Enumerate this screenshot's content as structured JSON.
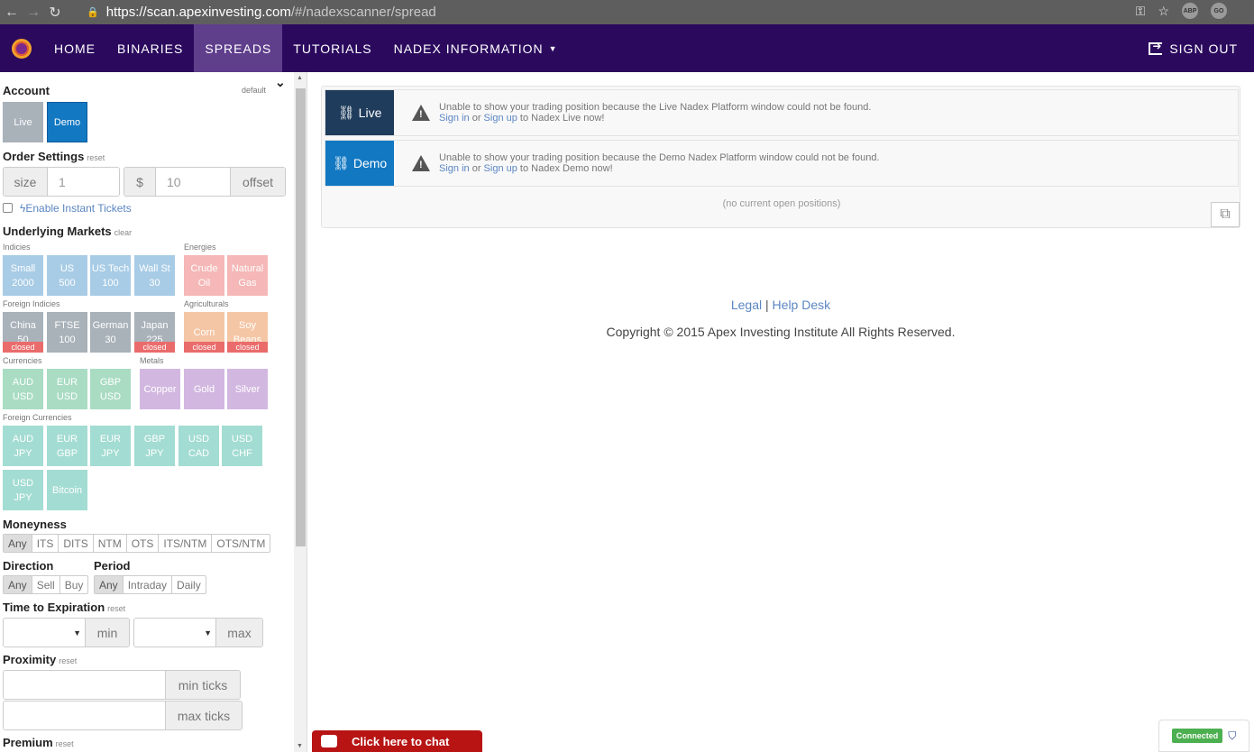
{
  "browser": {
    "url_host": "https://scan.apexinvesting.com",
    "url_path": "/#/nadexscanner/spread",
    "ext1": "ABP",
    "ext2": "GO"
  },
  "navbar": {
    "items": [
      "HOME",
      "BINARIES",
      "SPREADS",
      "TUTORIALS",
      "NADEX INFORMATION"
    ],
    "active": "SPREADS",
    "signout": "SIGN OUT"
  },
  "sidebar": {
    "account": {
      "label": "Account",
      "default_link": "default",
      "live": "Live",
      "demo": "Demo"
    },
    "order": {
      "label": "Order Settings",
      "reset": "reset",
      "size_addon": "size",
      "size_value": "1",
      "currency": "$",
      "offset_value": "10",
      "offset_addon": "offset"
    },
    "instant": "Enable Instant Tickets",
    "underlying": {
      "label": "Underlying Markets",
      "clear": "clear"
    },
    "groups": {
      "indicies": "Indicies",
      "energies": "Energies",
      "foreign_indicies": "Foreign Indicies",
      "agriculturals": "Agriculturals",
      "currencies": "Currencies",
      "metals": "Metals",
      "foreign_currencies": "Foreign Currencies"
    },
    "tiles": {
      "indicies": [
        [
          "Small",
          "2000"
        ],
        [
          "US",
          "500"
        ],
        [
          "US Tech",
          "100"
        ],
        [
          "Wall St",
          "30"
        ]
      ],
      "energies": [
        [
          "Crude",
          "Oil"
        ],
        [
          "Natural",
          "Gas"
        ]
      ],
      "foreign_indicies": [
        [
          "China",
          "50"
        ],
        [
          "FTSE",
          "100"
        ],
        [
          "German",
          "30"
        ],
        [
          "Japan",
          "225"
        ]
      ],
      "agriculturals": [
        [
          "Corn",
          ""
        ],
        [
          "Soy",
          "Beans"
        ]
      ],
      "currencies": [
        [
          "AUD",
          "USD"
        ],
        [
          "EUR",
          "USD"
        ],
        [
          "GBP",
          "USD"
        ]
      ],
      "metals": [
        "Copper",
        "Gold",
        "Silver"
      ],
      "foreign_currencies": [
        [
          "AUD",
          "JPY"
        ],
        [
          "EUR",
          "GBP"
        ],
        [
          "EUR",
          "JPY"
        ],
        [
          "GBP",
          "JPY"
        ],
        [
          "USD",
          "CAD"
        ],
        [
          "USD",
          "CHF"
        ],
        [
          "USD",
          "JPY"
        ],
        [
          "Bitcoin",
          ""
        ]
      ],
      "closed_label": "closed"
    },
    "moneyness": {
      "label": "Moneyness",
      "options": [
        "Any",
        "ITS",
        "DITS",
        "NTM",
        "OTS",
        "ITS/NTM",
        "OTS/NTM"
      ]
    },
    "direction": {
      "label": "Direction",
      "options": [
        "Any",
        "Sell",
        "Buy"
      ]
    },
    "period": {
      "label": "Period",
      "options": [
        "Any",
        "Intraday",
        "Daily"
      ]
    },
    "expiration": {
      "label": "Time to Expiration",
      "reset": "reset",
      "min": "min",
      "max": "max"
    },
    "proximity": {
      "label": "Proximity",
      "reset": "reset",
      "min": "min ticks",
      "max": "max ticks"
    },
    "premium": {
      "label": "Premium",
      "reset": "reset"
    }
  },
  "main": {
    "live": {
      "tag": "Live",
      "line1": "Unable to show your trading position because the Live Nadex Platform window could not be found.",
      "signin": "Sign in",
      "or": "or",
      "signup": "Sign up",
      "tail": "to Nadex Live now!"
    },
    "demo": {
      "tag": "Demo",
      "line1": "Unable to show your trading position because the Demo Nadex Platform window could not be found.",
      "signin": "Sign in",
      "or": "or",
      "signup": "Sign up",
      "tail": "to Nadex Demo now!"
    },
    "no_positions": "(no current open positions)",
    "footer": {
      "legal": "Legal",
      "sep": "|",
      "help": "Help Desk",
      "copyright": "Copyright © 2015 Apex Investing Institute All Rights Reserved."
    }
  },
  "chat": "Click here to chat",
  "status": "Connected",
  "colors": {
    "navbar": "#2b0a5e",
    "live_tag": "#1f3c5c",
    "demo_tag": "#1278c2",
    "chat": "#b81414"
  }
}
